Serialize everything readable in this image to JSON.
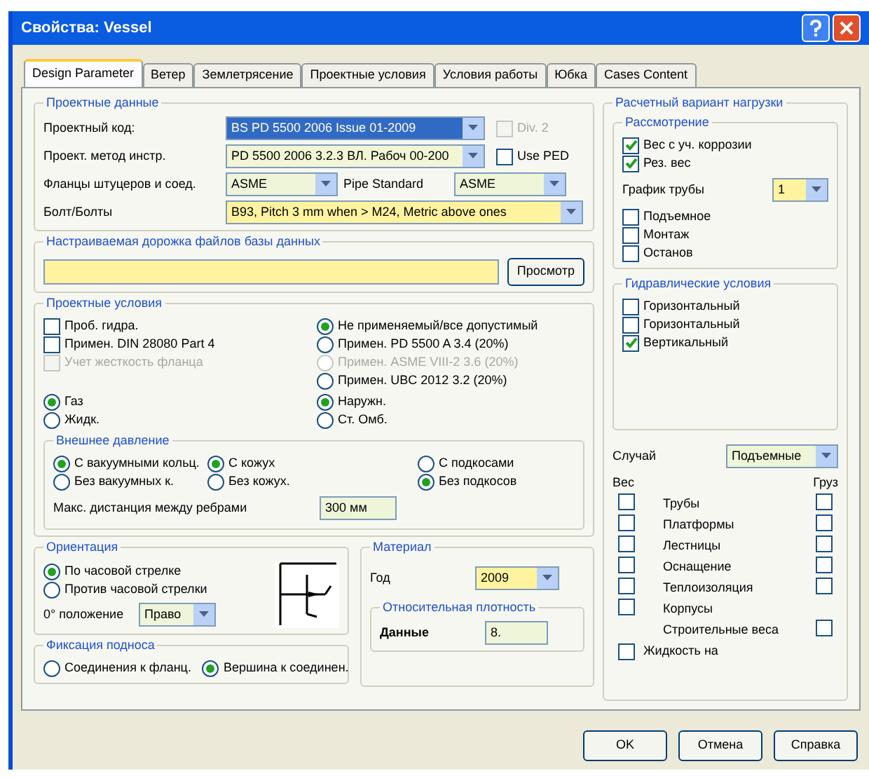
{
  "window": {
    "title": "Свойства: Vessel"
  },
  "tabs": [
    {
      "label": "Design Parameter",
      "selected": true
    },
    {
      "label": "Ветер",
      "selected": false
    },
    {
      "label": "Землетрясение",
      "selected": false
    },
    {
      "label": "Проектные условия",
      "selected": false
    },
    {
      "label": "Условия работы",
      "selected": false
    },
    {
      "label": "Юбка",
      "selected": false
    },
    {
      "label": "Cases Content",
      "selected": false
    }
  ],
  "design_data": {
    "title": "Проектные данные",
    "rows": [
      {
        "label": "Проектный код:",
        "items": [
          {
            "kind": "combo",
            "value": "BS PD 5500 2006 Issue 01-2009",
            "color": "#316ac5"
          }
        ],
        "check": {
          "label": "Div. 2",
          "checked": false,
          "disabled": true
        }
      },
      {
        "label": "Проект. метод инстр.",
        "items": [
          {
            "kind": "combo",
            "value": "PD 5500 2006 3.2.3 ВЛ. Рабоч 00-200",
            "color": "#f2f6d6"
          }
        ],
        "check": {
          "label": "Use PED",
          "checked": false,
          "disabled": false
        }
      },
      {
        "label": "Фланцы штуцеров и соед.",
        "items": [
          {
            "kind": "combo",
            "value": "ASME",
            "color": "#eef5d8"
          },
          {
            "kind": "label",
            "value": "Pipe Standard"
          },
          {
            "kind": "combo",
            "value": "ASME",
            "color": "#eef5d8"
          }
        ]
      },
      {
        "label": "Болт/Болты",
        "items": [
          {
            "kind": "combo",
            "value": "B93, Pitch 3 mm when > M24, Metric above ones",
            "color": "#fff3a0"
          }
        ]
      }
    ]
  },
  "db_path": {
    "title": "Настраиваемая дорожка файлов базы данных",
    "color": "#fff3a0",
    "button": "Просмотр"
  },
  "conditions": {
    "title": "Проектные условия",
    "checks": [
      {
        "label": "Проб. гидра.",
        "checked": false,
        "disabled": false
      },
      {
        "label": "Примен. DIN 28080 Part 4",
        "checked": false,
        "disabled": false
      },
      {
        "label": "Учет жесткость фланца",
        "checked": false,
        "disabled": true
      }
    ],
    "rules": [
      {
        "label": "Не применяемый/все допустимый",
        "selected": true,
        "disabled": false
      },
      {
        "label": "Примен. PD 5500 A 3.4 (20%)",
        "selected": false,
        "disabled": false
      },
      {
        "label": "Примен. ASME VIII-2 3.6 (20%)",
        "selected": false,
        "disabled": true
      },
      {
        "label": "Примен. UBC 2012 3.2 (20%)",
        "selected": false,
        "disabled": false
      }
    ],
    "fluid": [
      {
        "label": "Газ",
        "selected": true
      },
      {
        "label": "Жидк.",
        "selected": false
      }
    ],
    "side": [
      {
        "label": "Наружн.",
        "selected": true
      },
      {
        "label": "Ст. Омб.",
        "selected": false
      }
    ],
    "external": {
      "title": "Внешнее давление",
      "groups": [
        [
          {
            "label": "С вакуумными кольц.",
            "selected": true
          },
          {
            "label": "Без вакуумных к.",
            "selected": false
          }
        ],
        [
          {
            "label": "С кожух",
            "selected": true
          },
          {
            "label": "Без кожух.",
            "selected": false
          }
        ],
        [
          {
            "label": "С подкосами",
            "selected": false
          },
          {
            "label": "Без подкосов",
            "selected": true
          }
        ]
      ],
      "spacing_label": "Макс. дистанция между ребрами",
      "spacing_value": "300 мм"
    }
  },
  "orientation": {
    "title": "Ориентация",
    "options": [
      {
        "label": "По часовой стрелке",
        "selected": true
      },
      {
        "label": "Против часовой стрелки",
        "selected": false
      }
    ],
    "zero_label": "0° положение",
    "zero_value": "Право"
  },
  "tray": {
    "title": "Фиксация подноса",
    "options": [
      {
        "label": "Соединения к фланц.",
        "selected": false
      },
      {
        "label": "Вершина к соединен.",
        "selected": true
      }
    ]
  },
  "material": {
    "title": "Материал",
    "year_label": "Год",
    "year_value": "2009",
    "density": {
      "title": "Относительная плотность",
      "label": "Данные",
      "value": "8."
    }
  },
  "load": {
    "title": "Расчетный вариант нагрузки",
    "consider": {
      "title": "Рассмотрение",
      "checks": [
        {
          "label": "Вес с уч. коррозии",
          "checked": true
        },
        {
          "label": "Рез. вес",
          "checked": true
        }
      ],
      "schedule_label": "График трубы",
      "schedule_value": "1",
      "checks2": [
        {
          "label": "Подъемное",
          "checked": false
        },
        {
          "label": "Монтаж",
          "checked": false
        },
        {
          "label": "Останов",
          "checked": false
        }
      ]
    },
    "hydro": {
      "title": "Гидравлические условия",
      "checks": [
        {
          "label": "Горизонтальный",
          "checked": false
        },
        {
          "label": "Горизонтальный",
          "checked": false
        },
        {
          "label": "Вертикальный",
          "checked": true
        }
      ]
    },
    "case_label": "Случай",
    "case_value": "Подъемные",
    "weight_header": "Вес",
    "load_header": "Груз",
    "items": [
      {
        "kind": "both",
        "label": "Трубы",
        "weight": false,
        "load": false
      },
      {
        "kind": "both",
        "label": "Платформы",
        "weight": false,
        "load": false
      },
      {
        "kind": "both",
        "label": "Лестницы",
        "weight": false,
        "load": false
      },
      {
        "kind": "both",
        "label": "Оснащение",
        "weight": false,
        "load": false
      },
      {
        "kind": "both",
        "label": "Теплоизоляция",
        "weight": false,
        "load": false
      },
      {
        "kind": "weight_only",
        "label": "Корпусы",
        "weight": false
      },
      {
        "kind": "load_only",
        "label": "Строительные веса",
        "load": false
      },
      {
        "kind": "wide",
        "label": "Жидкость на",
        "weight": false
      }
    ]
  },
  "buttons": [
    "OK",
    "Отмена",
    "Справка"
  ]
}
